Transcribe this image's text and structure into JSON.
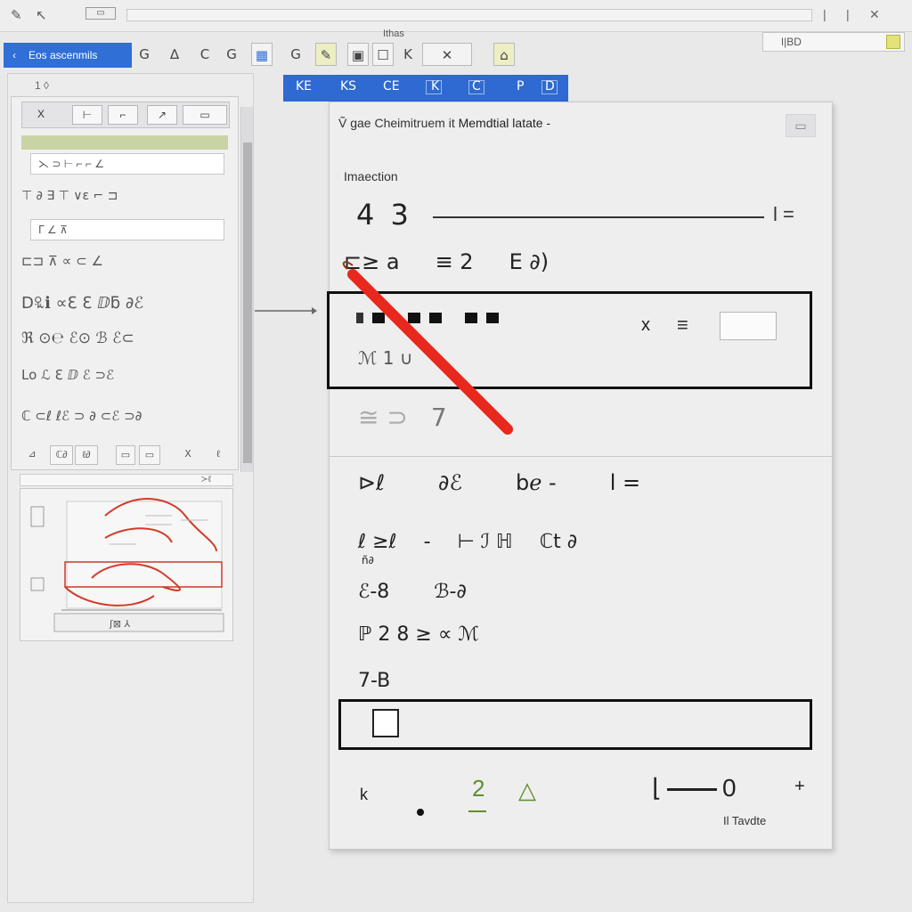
{
  "topbar": {
    "icons": [
      "pen-icon",
      "cursor-icon",
      "window-icon"
    ],
    "window_controls": [
      "|",
      "|",
      "✕"
    ]
  },
  "toolbar": {
    "app_tab_label": "Eos ascenmils",
    "title_text": "Ithas",
    "zoom_value": "ǀ|BD",
    "buttons": [
      "G",
      "∆",
      "C",
      "G",
      "▦",
      "G",
      "✎",
      "▣",
      "☐",
      "K",
      "✕",
      "⌂"
    ]
  },
  "left_panel": {
    "header": "1 ◊",
    "tools": [
      "X",
      "⊢",
      "⌐",
      "↗",
      "▭"
    ],
    "rows": [
      "⋋ ⊃ ⊢ ⌐ ⌐ ∠",
      "⊤ ∂ ∃ ⊤ ∨ε ⌐ ⊐",
      "ᒥ ∠ ⊼",
      "⊏⊐ ⊼ ∝ ⊂ ∠",
      "D꘢ℹ ∝ℇ ℇ ⅅƃ ∂ℰ",
      "ℜ ⊙℮ ℰ⊙ ℬ ℰ⊂",
      "Lo ℒ ℇ ⅅ ℰ ⊃ℰ",
      "ℂ ⊂ℓ ℓℰ ⊃ ∂ ⊂ℰ ⊃∂"
    ],
    "bottom_buttons": [
      "⊿",
      "ℂ∂",
      "ℓ∂",
      "▭",
      "▭",
      "Ⅹ",
      "ℓ"
    ],
    "thumbnail_caption": "≻ℓ"
  },
  "palette": {
    "items": [
      "KE",
      "KS",
      "CE",
      "K",
      "C",
      "P",
      "D"
    ]
  },
  "dialog": {
    "title_prefix": "Ṽ gae Cheimitruem it",
    "title_main": "Memdtial latate -",
    "close_glyph": "▭",
    "section_label": "Imaection",
    "value": "4 3",
    "value_end": "l =",
    "row2": [
      "⊏≥ a",
      "≡ 2",
      "E ∂)"
    ],
    "highlight_sub": "ℳ 1 ∪",
    "highlight_x": "x",
    "highlight_eq": "≡",
    "faded_a": "≅ ⊃",
    "faded_b": "7",
    "formula_rows": [
      [
        "⊳ℓ",
        "∂ℰ",
        "bℯ -",
        "l ="
      ],
      [
        "ℓ ≥ℓ",
        "-",
        "⊢ ℐ ℍ",
        "ℂt ∂"
      ],
      [
        "ℰ-8",
        "ℬ-∂"
      ],
      [
        "ℙ 2 8 ≥ ∝ ℳ"
      ],
      [
        "7-B"
      ]
    ],
    "formula_sub": "ñ∂",
    "footer": {
      "k": "k",
      "two": "2",
      "triangle": "△",
      "right_prefix": "⌊",
      "right_value": "0",
      "plus": "+",
      "caption": "Il Tavdte"
    }
  }
}
